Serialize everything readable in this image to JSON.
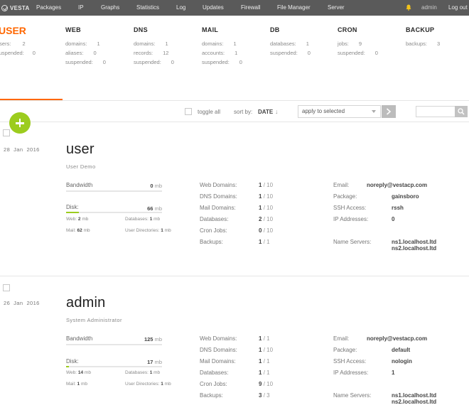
{
  "app": {
    "logo_text": "VESTA"
  },
  "nav": {
    "items": [
      "Packages",
      "IP",
      "Graphs",
      "Statistics",
      "Log",
      "Updates",
      "Firewall",
      "File Manager",
      "Server"
    ],
    "user": "admin",
    "logout": "Log out"
  },
  "stats": {
    "user": {
      "title": "USER",
      "rows": [
        {
          "label": "users:",
          "value": "2"
        },
        {
          "label": "suspended:",
          "value": "0"
        }
      ]
    },
    "web": {
      "title": "WEB",
      "rows": [
        {
          "label": "domains:",
          "value": "1"
        },
        {
          "label": "aliases:",
          "value": "0"
        },
        {
          "label": "suspended:",
          "value": "0"
        }
      ]
    },
    "dns": {
      "title": "DNS",
      "rows": [
        {
          "label": "domains:",
          "value": "1"
        },
        {
          "label": "records:",
          "value": "12"
        },
        {
          "label": "suspended:",
          "value": "0"
        }
      ]
    },
    "mail": {
      "title": "MAIL",
      "rows": [
        {
          "label": "domains:",
          "value": "1"
        },
        {
          "label": "accounts:",
          "value": "1"
        },
        {
          "label": "suspended:",
          "value": "0"
        }
      ]
    },
    "db": {
      "title": "DB",
      "rows": [
        {
          "label": "databases:",
          "value": "1"
        },
        {
          "label": "suspended:",
          "value": "0"
        }
      ]
    },
    "cron": {
      "title": "CRON",
      "rows": [
        {
          "label": "jobs:",
          "value": "9"
        },
        {
          "label": "suspended:",
          "value": "0"
        }
      ]
    },
    "backup": {
      "title": "BACKUP",
      "rows": [
        {
          "label": "backups:",
          "value": "3"
        }
      ]
    }
  },
  "toolbar": {
    "toggle_all": "toggle all",
    "sort_by": "sort by:",
    "sort_value": "DATE",
    "sort_arrow": "↓",
    "bulk_action": "apply to selected"
  },
  "labels": {
    "bandwidth": "Bandwidth",
    "disk": "Disk:",
    "mb": "mb",
    "web": "Web:",
    "databases_small": "Databases:",
    "mail": "Mail:",
    "user_dirs": "User Directories:",
    "web_domains": "Web Domains:",
    "dns_domains": "DNS Domains:",
    "mail_domains": "Mail Domains:",
    "databases": "Databases:",
    "cron_jobs": "Cron Jobs:",
    "backups": "Backups:",
    "email": "Email:",
    "package": "Package:",
    "ssh": "SSH Access:",
    "ip": "IP Addresses:",
    "ns": "Name Servers:",
    "sep": "/"
  },
  "users": [
    {
      "day": "28",
      "month": "Jan",
      "year": "2016",
      "name": "user",
      "full_name": "User Demo",
      "bandwidth": "0",
      "disk": "66",
      "disk_fraction": 0.13,
      "web": "2",
      "db": "1",
      "mail": "62",
      "dirs": "1",
      "web_domains": [
        "1",
        "10"
      ],
      "dns_domains": [
        "1",
        "10"
      ],
      "mail_domains": [
        "1",
        "10"
      ],
      "databases": [
        "2",
        "10"
      ],
      "cron_jobs": [
        "0",
        "10"
      ],
      "backups": [
        "1",
        "1"
      ],
      "email": "noreply@vestacp.com",
      "package": "gainsboro",
      "ssh": "rssh",
      "ip": "0",
      "ns1": "ns1.localhost.ltd",
      "ns2": "ns2.localhost.ltd"
    },
    {
      "day": "26",
      "month": "Jan",
      "year": "2016",
      "name": "admin",
      "full_name": "System Administrator",
      "bandwidth": "125",
      "disk": "17",
      "disk_fraction": 0.03,
      "web": "14",
      "db": "1",
      "mail": "1",
      "dirs": "1",
      "web_domains": [
        "1",
        "1"
      ],
      "dns_domains": [
        "1",
        "10"
      ],
      "mail_domains": [
        "1",
        "1"
      ],
      "databases": [
        "1",
        "1"
      ],
      "cron_jobs": [
        "9",
        "10"
      ],
      "backups": [
        "3",
        "3"
      ],
      "email": "noreply@vestacp.com",
      "package": "default",
      "ssh": "nologin",
      "ip": "1",
      "ns1": "ns1.localhost.ltd",
      "ns2": "ns2.localhost.ltd"
    }
  ],
  "colors": {
    "accent": "#ff6701",
    "green": "#9ccc1e",
    "topbar": "#5a5a5a"
  },
  "icons": [
    "vesta-logo-icon",
    "bell-icon",
    "chevron-down-icon",
    "arrow-right-icon",
    "search-icon",
    "plus-icon"
  ]
}
